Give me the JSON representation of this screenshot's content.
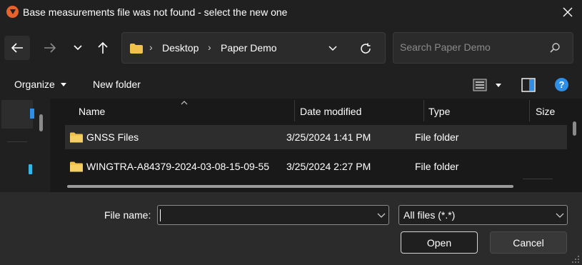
{
  "window": {
    "title": "Base measurements file was not found - select the new one",
    "app_icon": "app-logo-icon",
    "close_icon": "close-icon"
  },
  "navigation": {
    "back_icon": "arrow-left-icon",
    "forward_icon": "arrow-right-icon",
    "recent_icon": "chevron-down-icon",
    "up_icon": "arrow-up-icon",
    "address": {
      "folder_icon": "folder-icon",
      "breadcrumbs": [
        "Desktop",
        "Paper Demo"
      ],
      "separator": "›",
      "dropdown_icon": "chevron-down-icon",
      "refresh_icon": "refresh-icon"
    },
    "search": {
      "placeholder": "Search Paper Demo",
      "value": "",
      "icon": "search-icon"
    }
  },
  "toolbar": {
    "organize_label": "Organize",
    "new_folder_label": "New folder",
    "view_icon": "list-view-icon",
    "preview_icon": "preview-pane-icon",
    "help_label": "?"
  },
  "file_list": {
    "columns": [
      "Name",
      "Date modified",
      "Type",
      "Size"
    ],
    "rows": [
      {
        "name": "GNSS Files",
        "date_modified": "3/25/2024 1:41 PM",
        "type": "File folder",
        "size": "",
        "icon": "folder-icon",
        "selected": true
      },
      {
        "name": "WINGTRA-A84379-2024-03-08-15-09-55",
        "date_modified": "3/25/2024 2:27 PM",
        "type": "File folder",
        "size": "",
        "icon": "folder-icon",
        "selected": false
      }
    ]
  },
  "footer": {
    "file_name_label": "File name:",
    "file_name_value": "",
    "file_type_value": "All files (*.*)",
    "open_label": "Open",
    "cancel_label": "Cancel"
  },
  "colors": {
    "background": "#202020",
    "accent": "#2e8fe8",
    "folder": "#f0c24b",
    "bottom_panel": "#2b2b2b"
  }
}
